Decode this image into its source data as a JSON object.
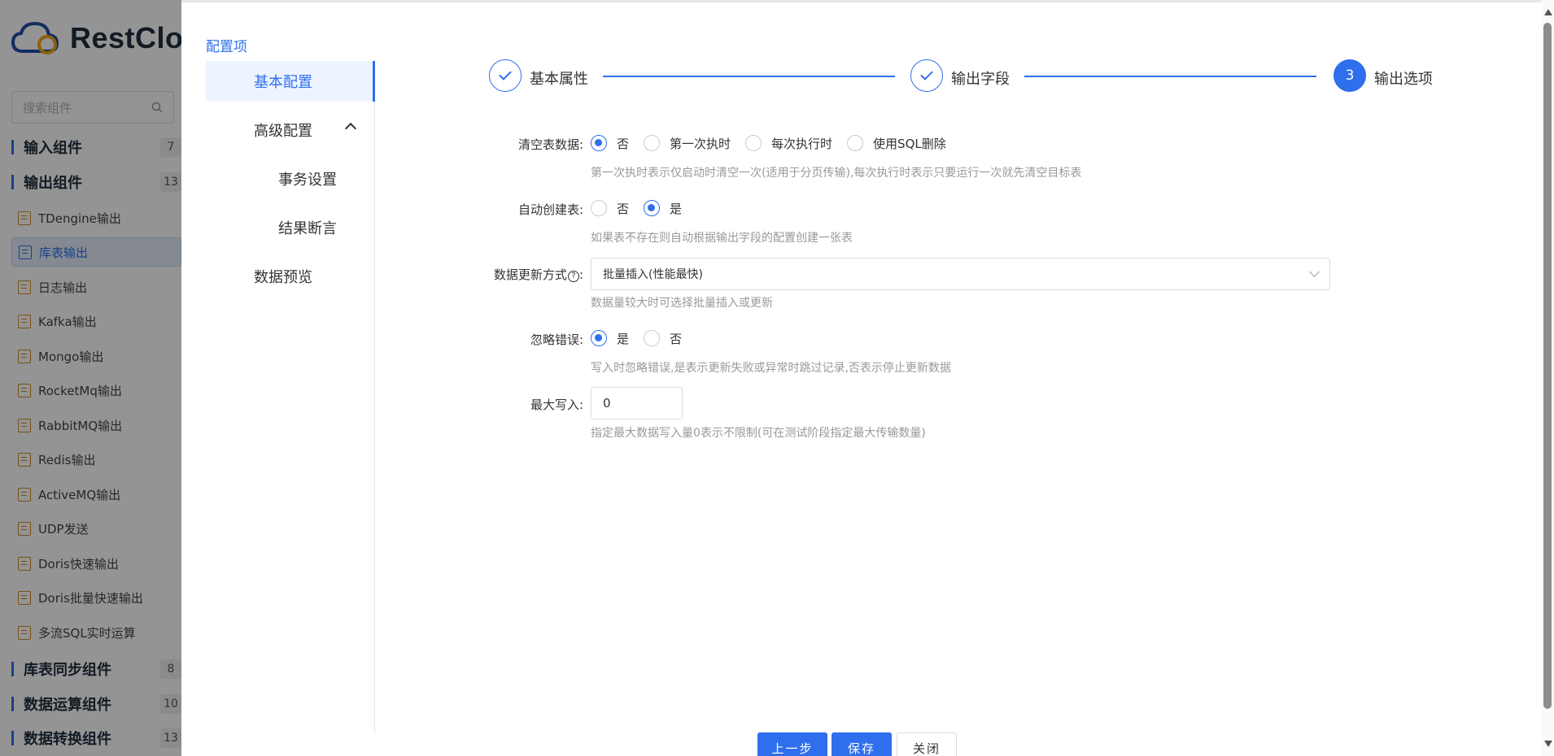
{
  "app": {
    "logo_text": "RestClo",
    "search_placeholder": "搜索组件",
    "groups": [
      {
        "label": "输入组件",
        "count": "7"
      },
      {
        "label": "输出组件",
        "count": "13"
      },
      {
        "label": "库表同步组件",
        "count": "8"
      },
      {
        "label": "数据运算组件",
        "count": "10"
      },
      {
        "label": "数据转换组件",
        "count": "13"
      }
    ],
    "items": [
      "TDengine输出",
      "库表输出",
      "日志输出",
      "Kafka输出",
      "Mongo输出",
      "RocketMq输出",
      "RabbitMQ输出",
      "Redis输出",
      "ActiveMQ输出",
      "UDP发送",
      "Doris快速输出",
      "Doris批量快速输出",
      "多流SQL实时运算"
    ]
  },
  "drawer": {
    "config_title": "配置项",
    "menu": {
      "basic": "基本配置",
      "advanced": "高级配置",
      "transaction": "事务设置",
      "assertion": "结果断言",
      "preview": "数据预览"
    },
    "steps": [
      {
        "label": "基本属性",
        "state": "done"
      },
      {
        "label": "输出字段",
        "state": "done"
      },
      {
        "label": "输出选项",
        "state": "current",
        "number": "3"
      }
    ],
    "form": {
      "clear_table": {
        "label": "清空表数据:",
        "options": [
          "否",
          "第一次执时",
          "每次执行时",
          "使用SQL删除"
        ],
        "selected": 0,
        "hint": "第一次执时表示仅启动时清空一次(适用于分页传输),每次执行时表示只要运行一次就先清空目标表"
      },
      "auto_create": {
        "label": "自动创建表:",
        "options": [
          "否",
          "是"
        ],
        "selected": 1,
        "hint": "如果表不存在则自动根据输出字段的配置创建一张表"
      },
      "update_mode": {
        "label": "数据更新方式",
        "help_icon": "?",
        "colon": ":",
        "value": "批量插入(性能最快)",
        "hint": "数据量较大时可选择批量插入或更新"
      },
      "ignore_error": {
        "label": "忽略错误:",
        "options": [
          "是",
          "否"
        ],
        "selected": 0,
        "hint": "写入时忽略错误,是表示更新失败或异常时跳过记录,否表示停止更新数据"
      },
      "max_write": {
        "label": "最大写入:",
        "value": "0",
        "hint": "指定最大数据写入量0表示不限制(可在测试阶段指定最大传输数量)"
      }
    },
    "buttons": {
      "prev": "上一步",
      "save": "保存",
      "close": "关闭"
    }
  },
  "colors": {
    "accent": "#2f6fed",
    "mask": "rgba(0,0,0,0.42)"
  }
}
